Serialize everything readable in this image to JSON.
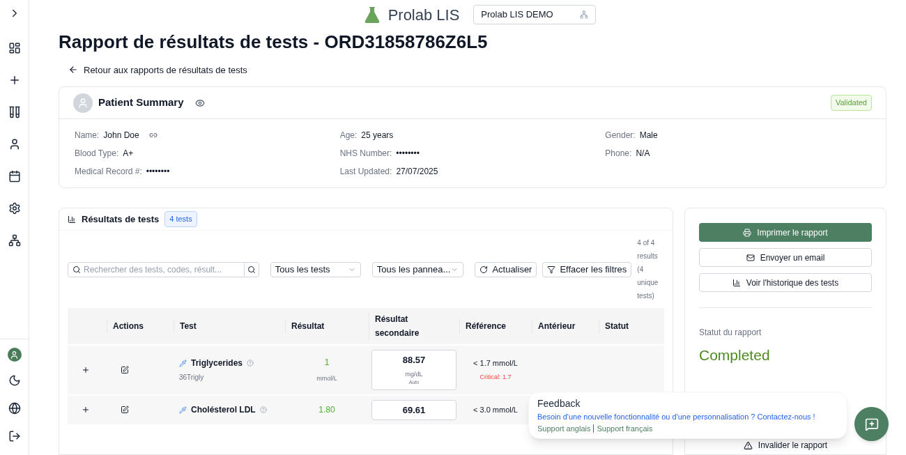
{
  "header": {
    "app_name": "Prolab LIS",
    "lab_select": "Prolab LIS DEMO"
  },
  "title": "Rapport de résultats de tests - ORD31858786Z6L5",
  "back_link": "Retour aux rapports de résultats de tests",
  "patient": {
    "title": "Patient Summary",
    "status": "Validated",
    "fields": [
      {
        "label": "Name:",
        "value": "John Doe",
        "kind": "link"
      },
      {
        "label": "Age:",
        "value": "25 years",
        "kind": "text"
      },
      {
        "label": "Gender:",
        "value": "Male",
        "kind": "text"
      },
      {
        "label": "Blood Type:",
        "value": "A+",
        "kind": "text"
      },
      {
        "label": "NHS Number:",
        "value": "••••••••",
        "kind": "text"
      },
      {
        "label": "Phone:",
        "value": "N/A",
        "kind": "text"
      },
      {
        "label": "Medical Record #:",
        "value": "••••••••",
        "kind": "text"
      },
      {
        "label": "Last Updated:",
        "value": "27/07/2025",
        "kind": "text"
      }
    ]
  },
  "results": {
    "title": "Résultats de tests",
    "count": "4 tests",
    "search": {
      "placeholder": "Rechercher des tests, codes, résult..."
    },
    "filters": [
      "Tous les tests",
      "Tous les pannea..."
    ],
    "refresh": "Actualiser",
    "clear": "Effacer les filtres",
    "summary": "4 of 4 results (4 unique tests)",
    "columns": [
      "Actions",
      "Test",
      "Résultat",
      "Résultat secondaire",
      "Référence",
      "Antérieur",
      "Statut"
    ],
    "rows": [
      {
        "name": "Triglycerides",
        "code": "36Trigly",
        "result": "1",
        "unit": "mmol/L",
        "secondary": "88.57",
        "secondary_unit": "mg/dL",
        "secondary_note": "Auto",
        "reference": "< 1.7 mmol/L",
        "critical": "Critical: 1.7"
      },
      {
        "name": "Cholésterol LDL",
        "result": "1.80",
        "secondary": "69.61",
        "reference": "< 3.0 mmol/L"
      }
    ]
  },
  "actions": {
    "buttons": [
      {
        "label": "Imprimer le rapport",
        "kind": "primary"
      },
      {
        "label": "Envoyer un email",
        "kind": "email"
      },
      {
        "label": "Voir l'historique des tests",
        "kind": "history"
      }
    ],
    "status_label": "Statut du rapport",
    "status": "Completed",
    "invalidate": "Invalider le rapport"
  },
  "feedback": {
    "title": "Feedback",
    "message": "Besoin d'une nouvelle fonctionnalité ou d'une personnalisation ? Contactez-nous !",
    "links": [
      "Support anglais",
      "Support français"
    ]
  }
}
